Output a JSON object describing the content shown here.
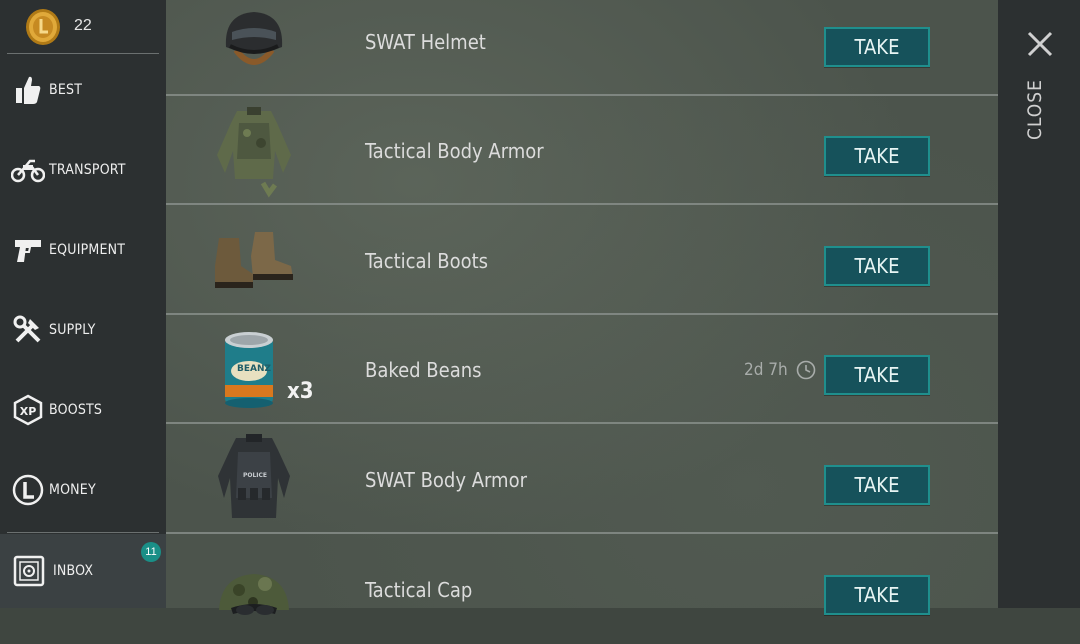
{
  "currency": {
    "amount": "22",
    "icon": "coin-icon"
  },
  "nav": [
    {
      "label": "BEST",
      "icon": "thumbs-up-icon"
    },
    {
      "label": "TRANSPORT",
      "icon": "motorcycle-icon"
    },
    {
      "label": "EQUIPMENT",
      "icon": "pistol-icon"
    },
    {
      "label": "SUPPLY",
      "icon": "tools-icon"
    },
    {
      "label": "BOOSTS",
      "icon": "xp-icon"
    },
    {
      "label": "MONEY",
      "icon": "money-icon"
    },
    {
      "label": "INBOX",
      "icon": "safe-icon",
      "badge": "11"
    }
  ],
  "items": [
    {
      "name": "SWAT Helmet",
      "action": "TAKE",
      "icon": "swat-helmet-icon"
    },
    {
      "name": "Tactical Body Armor",
      "action": "TAKE",
      "icon": "tactical-body-armor-icon"
    },
    {
      "name": "Tactical Boots",
      "action": "TAKE",
      "icon": "tactical-boots-icon"
    },
    {
      "name": "Baked Beans",
      "action": "TAKE",
      "icon": "baked-beans-can-icon",
      "quantity": "x3",
      "timer": "2d 7h",
      "can_label": "BEANZ"
    },
    {
      "name": "SWAT Body Armor",
      "action": "TAKE",
      "icon": "swat-body-armor-icon",
      "vest_label": "POLICE"
    },
    {
      "name": "Tactical Cap",
      "action": "TAKE",
      "icon": "tactical-cap-icon"
    }
  ],
  "close": {
    "label": "CLOSE"
  },
  "colors": {
    "accent": "#16525b",
    "accent_border": "#1f8f8d",
    "badge": "#1a8f87",
    "sidebar": "#2c3031"
  }
}
